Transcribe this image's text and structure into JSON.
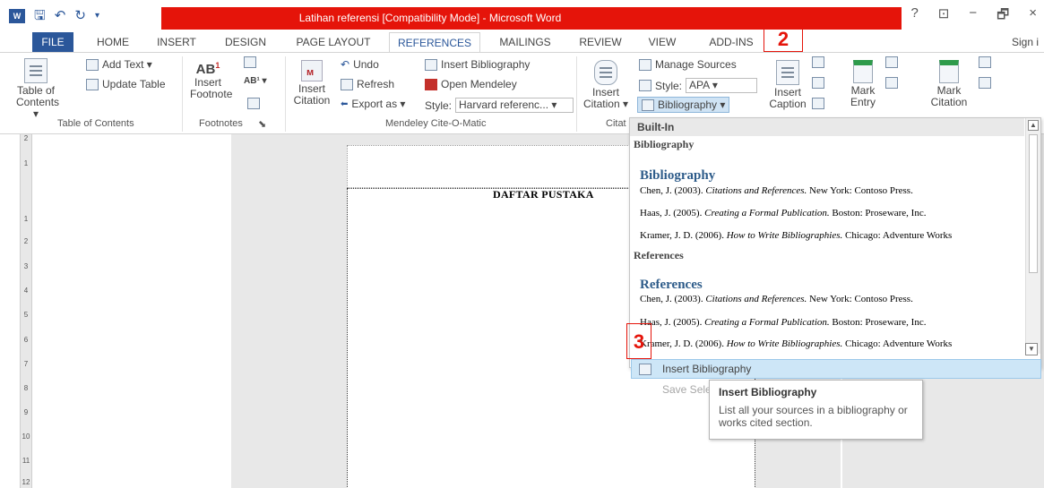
{
  "window": {
    "title": "Latihan referensi [Compatibility Mode] - Microsoft Word",
    "help": "?",
    "controls": [
      "−",
      "🗗",
      "×"
    ]
  },
  "colors": {
    "word_blue": "#2b579a",
    "callout_red": "#e5140a",
    "hover_blue": "#cde6f7"
  },
  "tabs": [
    "FILE",
    "HOME",
    "INSERT",
    "DESIGN",
    "PAGE LAYOUT",
    "REFERENCES",
    "MAILINGS",
    "REVIEW",
    "VIEW",
    "ADD-INS"
  ],
  "active_tab": "REFERENCES",
  "signin": "Sign i",
  "callouts": {
    "two": "2",
    "three": "3"
  },
  "ribbon": {
    "toc": {
      "label1": "Table of",
      "label2": "Contents ▾",
      "add_text": "Add Text ▾",
      "update_table": "Update Table",
      "group": "Table of Contents"
    },
    "footnotes": {
      "insert1": "Insert",
      "insert2": "Footnote",
      "group": "Footnotes"
    },
    "mendeley": {
      "insert_citation1": "Insert",
      "insert_citation2": "Citation",
      "undo": "Undo",
      "refresh": "Refresh",
      "export_as": "Export as ▾",
      "style_label": "Style:",
      "style_value": "Harvard referenc...",
      "insert_bibliography": "Insert Bibliography",
      "open_mendeley": "Open Mendeley",
      "group": "Mendeley Cite-O-Matic"
    },
    "citations": {
      "insert1": "Insert",
      "insert2": "Citation ▾",
      "manage_sources": "Manage Sources",
      "style_label": "Style:",
      "style_value": "APA",
      "bibliography": "Bibliography ▾",
      "group": "Citat"
    },
    "captions": {
      "insert1": "Insert",
      "insert2": "Caption"
    },
    "index": {
      "mark1": "Mark",
      "mark2": "Entry"
    },
    "toa": {
      "mark1": "Mark",
      "mark2": "Citation"
    }
  },
  "ruler": [
    "2",
    "1",
    "1",
    "2",
    "3",
    "4",
    "5",
    "6",
    "7",
    "8",
    "9",
    "10",
    "11",
    "12"
  ],
  "document": {
    "heading": "DAFTAR PUSTAKA"
  },
  "dropdown": {
    "header": "Built-In",
    "items": [
      {
        "section": "Bibliography",
        "title": "Bibliography",
        "entries": [
          {
            "pre": "Chen, J. (2003). ",
            "italic": "Citations and References.",
            "post": " New York: Contoso Press."
          },
          {
            "pre": "Haas, J. (2005). ",
            "italic": "Creating a Formal Publication.",
            "post": " Boston: Proseware, Inc."
          },
          {
            "pre": "Kramer, J. D. (2006). ",
            "italic": "How to Write Bibliographies.",
            "post": " Chicago: Adventure Works"
          }
        ]
      },
      {
        "section": "References",
        "title": "References",
        "entries": [
          {
            "pre": "Chen, J. (2003). ",
            "italic": "Citations and References.",
            "post": " New York: Contoso Press."
          },
          {
            "pre": "Haas, J. (2005). ",
            "italic": "Creating a Formal Publication.",
            "post": " Boston: Proseware, Inc."
          },
          {
            "pre": "Kramer, J. D. (2006). ",
            "italic": "How to Write Bibliographies.",
            "post": " Chicago: Adventure Works"
          }
        ]
      }
    ],
    "insert_bibliography": "Insert Bibliography",
    "save_selection": "Save Sele"
  },
  "tooltip": {
    "title": "Insert Bibliography",
    "body": "List all your sources in a bibliography or works cited section."
  }
}
